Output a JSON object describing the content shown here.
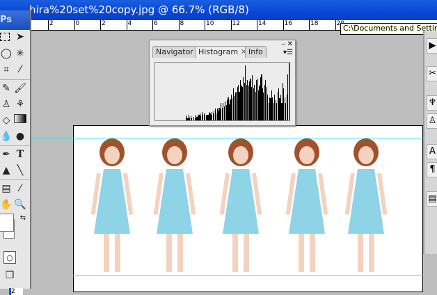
{
  "window": {
    "title": "hira%20set%20copy.jpg @ 66.7% (RGB/8)",
    "path_tooltip": "C:\\Documents and Settings\\"
  },
  "ruler": {
    "ticks": [
      "2",
      "0",
      "2",
      "4",
      "6",
      "8",
      "10",
      "12",
      "14",
      "16",
      "18",
      "20"
    ]
  },
  "toolbox": {
    "logo": "Ps",
    "bottom_label": "2"
  },
  "panel": {
    "tabs": [
      "Navigator",
      "Histogram",
      "Info"
    ],
    "active_tab": "Histogram"
  },
  "histogram": {
    "levels": [
      0,
      0,
      0,
      0,
      0,
      0,
      0,
      0,
      0,
      0,
      0,
      0,
      0,
      0,
      0,
      0,
      0,
      0,
      0,
      0,
      0,
      0,
      0,
      0,
      0,
      0,
      0,
      0,
      0,
      0,
      0.05,
      0.08,
      0.04,
      0.1,
      0.05,
      0.07,
      0.04,
      0,
      0.06,
      0.04,
      0.1,
      0.06,
      0.09,
      0.1,
      0.12,
      0.08,
      0.15,
      0.1,
      0.12,
      0.08,
      0.1,
      0.09,
      0.1,
      0.14,
      0.12,
      0.1,
      0.15,
      0.12,
      0.17,
      0.2,
      0.12,
      0.2,
      0.16,
      0.22,
      0.2,
      0.3,
      0.22,
      0.3,
      0.24,
      0.32,
      0.26,
      0.35,
      0.4,
      0.28,
      0.36,
      0.45,
      0.38,
      0.55,
      0.42,
      0.48,
      0.5,
      0.58,
      0.62,
      0.5,
      0.7,
      0.6,
      0.58,
      0.75,
      0.65,
      0.95,
      0.62,
      0.7,
      0.6,
      0.68,
      0.72,
      0.58,
      0.78,
      0.55,
      0.62,
      0.5,
      0.7,
      0.72,
      0.52,
      0.6,
      0.75,
      0.8,
      0.55,
      0.48,
      0.62,
      0.7,
      0.58,
      0.44,
      0.3,
      0.4,
      0.38,
      0.52,
      0.4,
      0.3,
      0.45,
      0.35,
      0.3,
      0.5,
      0.55,
      0.38,
      0.45,
      0.3,
      0.65,
      0.55,
      0.4,
      0.3,
      0.45,
      0.8,
      1.0
    ]
  }
}
